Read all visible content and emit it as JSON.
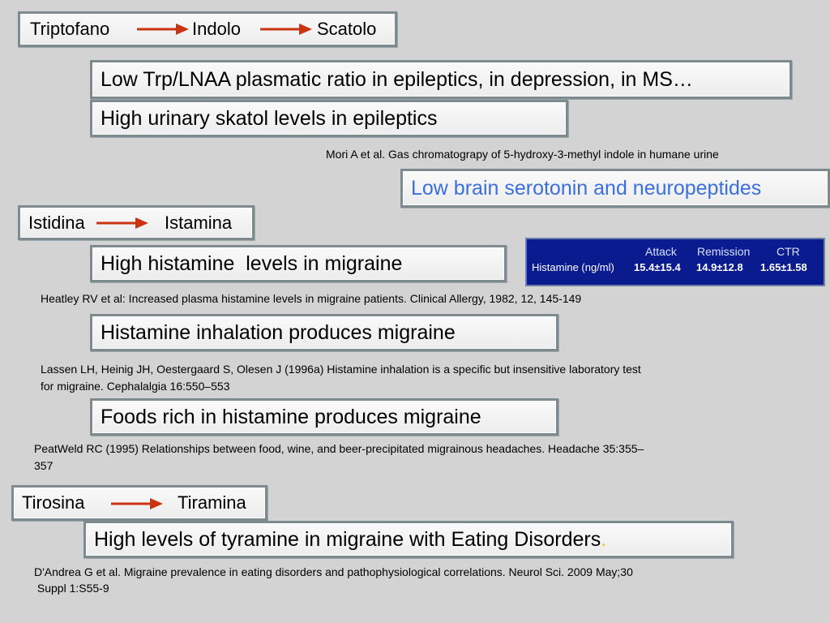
{
  "chains": [
    {
      "from": "Triptofano",
      "mid": "Indolo",
      "to": "Scatolo"
    },
    {
      "from": "Istidina",
      "to": "Istamina"
    },
    {
      "from": "Tirosina",
      "to": "Tiramina"
    }
  ],
  "statements": {
    "trp_ratio": "Low Trp/LNAA plasmatic ratio in epileptics, in depression, in MS…",
    "skatol": "High urinary skatol levels in epileptics",
    "serotonin": "Low brain serotonin and neuropeptides",
    "histamine_levels": "High histamine  levels in migraine",
    "histamine_inhalation": "Histamine inhalation produces migraine",
    "foods_histamine": "Foods rich in histamine produces migraine",
    "tyramine": "High levels of tyramine in migraine with Eating Disorders",
    "tyramine_dot": "."
  },
  "references": {
    "mori": "Mori A et al. Gas chromatograpy of 5-hydroxy-3-methyl indole in humane urine",
    "heatley": "Heatley RV et al: Increased plasma histamine levels in migraine patients. Clinical Allergy, 1982, 12, 145-149",
    "lassen_line1": "Lassen LH, Heinig JH, Oestergaard S, Olesen J (1996a) Histamine inhalation is a specific but insensitive laboratory test",
    "lassen_line2": "for migraine. Cephalalgia 16:550–553",
    "peatweld_line1": "PeatWeld RC (1995) Relationships between food, wine, and beer-precipitated migrainous headaches. Headache 35:355–",
    "peatweld_line2": "357",
    "dandrea_line1": "D'Andrea G et al. Migraine prevalence in eating disorders and pathophysiological correlations. Neurol Sci. 2009 May;30",
    "dandrea_line2": " Suppl 1:S55-9"
  },
  "histamine_table": {
    "headers": [
      "Attack",
      "Remission",
      "CTR"
    ],
    "row_label": "Histamine (ng/ml)",
    "values": [
      "15.4±15.4",
      "14.9±12.8",
      "1.65±1.58"
    ]
  },
  "colors": {
    "arrow": "#cc3311",
    "accent_text": "#3b6fe0",
    "table_bg": "#0a1a8f"
  }
}
